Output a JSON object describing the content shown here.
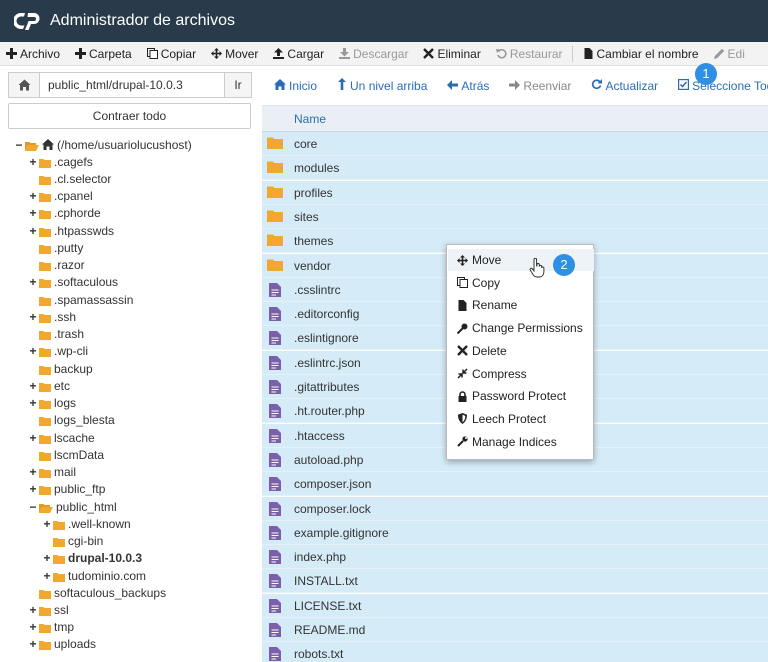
{
  "app": {
    "title": "Administrador de archivos"
  },
  "toolbar": {
    "items": [
      {
        "label": "Archivo",
        "icon": "plus-icon",
        "disabled": false
      },
      {
        "label": "Carpeta",
        "icon": "plus-icon",
        "disabled": false
      },
      {
        "label": "Copiar",
        "icon": "copy-icon",
        "disabled": false
      },
      {
        "label": "Mover",
        "icon": "move-icon",
        "disabled": false
      },
      {
        "label": "Cargar",
        "icon": "upload-icon",
        "disabled": false
      },
      {
        "label": "Descargar",
        "icon": "download-icon",
        "disabled": true
      },
      {
        "label": "Eliminar",
        "icon": "x-icon",
        "disabled": false
      },
      {
        "label": "Restaurar",
        "icon": "undo-icon",
        "disabled": true
      },
      {
        "label": "Cambiar el nombre",
        "icon": "file-icon",
        "disabled": false
      },
      {
        "label": "Edi",
        "icon": "pencil-icon",
        "disabled": true
      }
    ]
  },
  "path": {
    "value": "public_html/drupal-10.0.3",
    "go_label": "Ir"
  },
  "collapse_label": "Contraer todo",
  "tree": [
    {
      "label": "(/home/usuariolucushost)",
      "toggle": "−",
      "depth": 0,
      "home": true
    },
    {
      "label": ".cagefs",
      "toggle": "+",
      "depth": 1
    },
    {
      "label": ".cl.selector",
      "toggle": "",
      "depth": 1
    },
    {
      "label": ".cpanel",
      "toggle": "+",
      "depth": 1
    },
    {
      "label": ".cphorde",
      "toggle": "+",
      "depth": 1
    },
    {
      "label": ".htpasswds",
      "toggle": "+",
      "depth": 1
    },
    {
      "label": ".putty",
      "toggle": "",
      "depth": 1
    },
    {
      "label": ".razor",
      "toggle": "",
      "depth": 1
    },
    {
      "label": ".softaculous",
      "toggle": "+",
      "depth": 1
    },
    {
      "label": ".spamassassin",
      "toggle": "",
      "depth": 1
    },
    {
      "label": ".ssh",
      "toggle": "+",
      "depth": 1
    },
    {
      "label": ".trash",
      "toggle": "",
      "depth": 1
    },
    {
      "label": ".wp-cli",
      "toggle": "+",
      "depth": 1
    },
    {
      "label": "backup",
      "toggle": "",
      "depth": 1
    },
    {
      "label": "etc",
      "toggle": "+",
      "depth": 1
    },
    {
      "label": "logs",
      "toggle": "+",
      "depth": 1
    },
    {
      "label": "logs_blesta",
      "toggle": "",
      "depth": 1
    },
    {
      "label": "lscache",
      "toggle": "+",
      "depth": 1
    },
    {
      "label": "lscmData",
      "toggle": "",
      "depth": 1
    },
    {
      "label": "mail",
      "toggle": "+",
      "depth": 1
    },
    {
      "label": "public_ftp",
      "toggle": "+",
      "depth": 1
    },
    {
      "label": "public_html",
      "toggle": "−",
      "depth": 1,
      "open": true
    },
    {
      "label": ".well-known",
      "toggle": "+",
      "depth": 2
    },
    {
      "label": "cgi-bin",
      "toggle": "",
      "depth": 2
    },
    {
      "label": "drupal-10.0.3",
      "toggle": "+",
      "depth": 2,
      "bold": true
    },
    {
      "label": "tudominio.com",
      "toggle": "+",
      "depth": 2
    },
    {
      "label": "softaculous_backups",
      "toggle": "",
      "depth": 1
    },
    {
      "label": "ssl",
      "toggle": "+",
      "depth": 1
    },
    {
      "label": "tmp",
      "toggle": "+",
      "depth": 1
    },
    {
      "label": "uploads",
      "toggle": "+",
      "depth": 1
    }
  ],
  "nav": {
    "items": [
      {
        "label": "Inicio",
        "icon": "home-icon",
        "disabled": false
      },
      {
        "label": "Un nivel arriba",
        "icon": "level-up-icon",
        "disabled": false
      },
      {
        "label": "Atrás",
        "icon": "arrow-left-icon",
        "disabled": false
      },
      {
        "label": "Reenviar",
        "icon": "arrow-right-icon",
        "disabled": true
      },
      {
        "label": "Actualizar",
        "icon": "refresh-icon",
        "disabled": false
      },
      {
        "label": "Seleccione Todo",
        "icon": "check-square-icon",
        "disabled": false
      }
    ]
  },
  "table": {
    "name_header": "Name"
  },
  "files": [
    {
      "name": "core",
      "type": "folder"
    },
    {
      "name": "modules",
      "type": "folder"
    },
    {
      "name": "profiles",
      "type": "folder"
    },
    {
      "name": "sites",
      "type": "folder"
    },
    {
      "name": "themes",
      "type": "folder"
    },
    {
      "name": "vendor",
      "type": "folder"
    },
    {
      "name": ".csslintrc",
      "type": "file"
    },
    {
      "name": ".editorconfig",
      "type": "file"
    },
    {
      "name": ".eslintignore",
      "type": "file"
    },
    {
      "name": ".eslintrc.json",
      "type": "file"
    },
    {
      "name": ".gitattributes",
      "type": "file"
    },
    {
      "name": ".ht.router.php",
      "type": "file"
    },
    {
      "name": ".htaccess",
      "type": "file"
    },
    {
      "name": "autoload.php",
      "type": "file"
    },
    {
      "name": "composer.json",
      "type": "file"
    },
    {
      "name": "composer.lock",
      "type": "file"
    },
    {
      "name": "example.gitignore",
      "type": "file"
    },
    {
      "name": "index.php",
      "type": "file"
    },
    {
      "name": "INSTALL.txt",
      "type": "file"
    },
    {
      "name": "LICENSE.txt",
      "type": "file"
    },
    {
      "name": "README.md",
      "type": "file"
    },
    {
      "name": "robots.txt",
      "type": "file"
    }
  ],
  "context_menu": {
    "items": [
      {
        "label": "Move",
        "icon": "move-icon",
        "hover": true
      },
      {
        "label": "Copy",
        "icon": "copy-icon"
      },
      {
        "label": "Rename",
        "icon": "file-icon"
      },
      {
        "label": "Change Permissions",
        "icon": "key-icon"
      },
      {
        "label": "Delete",
        "icon": "x-icon"
      },
      {
        "label": "Compress",
        "icon": "compress-icon"
      },
      {
        "label": "Password Protect",
        "icon": "lock-icon"
      },
      {
        "label": "Leech Protect",
        "icon": "shield-icon"
      },
      {
        "label": "Manage Indices",
        "icon": "wrench-icon"
      }
    ]
  },
  "badges": {
    "first": "1",
    "second": "2"
  },
  "colors": {
    "header_bg": "#293a4a",
    "accent": "#2a6db4",
    "row_selected": "#d5ebf7",
    "folder": "#f0a92e",
    "file_icon": "#7b5fa8",
    "badge": "#2d8fe6"
  }
}
